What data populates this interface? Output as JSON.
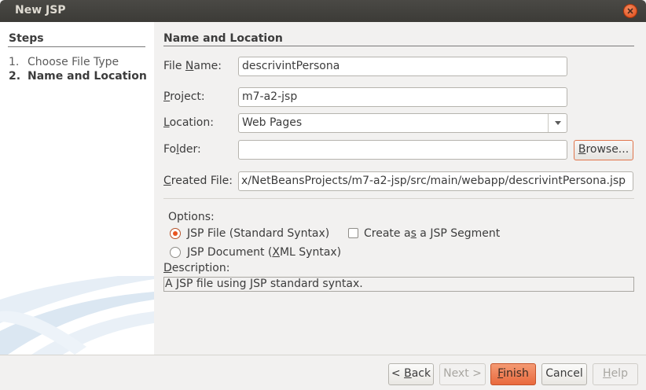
{
  "window": {
    "title": "New JSP"
  },
  "steps": {
    "title": "Steps",
    "items": [
      {
        "num": "1.",
        "label": "Choose File Type"
      },
      {
        "num": "2.",
        "label": "Name and Location"
      }
    ]
  },
  "panel": {
    "title": "Name and Location"
  },
  "form": {
    "file_name": {
      "label_pre": "File ",
      "label_key": "N",
      "label_post": "ame:",
      "value": "descrivintPersona"
    },
    "project": {
      "label_key": "P",
      "label_post": "roject:",
      "value": "m7-a2-jsp"
    },
    "location": {
      "label_key": "L",
      "label_post": "ocation:",
      "value": "Web Pages"
    },
    "folder": {
      "label_pre": "Fo",
      "label_key": "l",
      "label_post": "der:",
      "value": "",
      "browse_pre": "",
      "browse_key": "B",
      "browse_post": "rowse..."
    },
    "created_file": {
      "label_key": "C",
      "label_post": "reated File:",
      "value": "x/NetBeansProjects/m7-a2-jsp/src/main/webapp/descrivintPersona.jsp"
    }
  },
  "options": {
    "title": "Options:",
    "jsp_file": {
      "key": "J",
      "post": "SP File (Standard Syntax)",
      "selected": true
    },
    "jsp_segment": {
      "pre": "Create a",
      "key": "s",
      "post": " a JSP Segment",
      "checked": false
    },
    "jsp_document": {
      "pre": "JSP Document (",
      "key": "X",
      "post": "ML Syntax)",
      "selected": false
    }
  },
  "description": {
    "label_key": "D",
    "label_post": "escription:",
    "text": "A JSP file using JSP standard syntax."
  },
  "buttons": {
    "back": {
      "pre": "< ",
      "key": "B",
      "post": "ack"
    },
    "next": {
      "label": "Next >"
    },
    "finish": {
      "key": "F",
      "post": "inish"
    },
    "cancel": {
      "label": "Cancel"
    },
    "help": {
      "key": "H",
      "post": "elp"
    }
  },
  "colors": {
    "accent": "#e95420",
    "title_bar": "#3c3b37",
    "panel_bg": "#f2f1f0"
  }
}
